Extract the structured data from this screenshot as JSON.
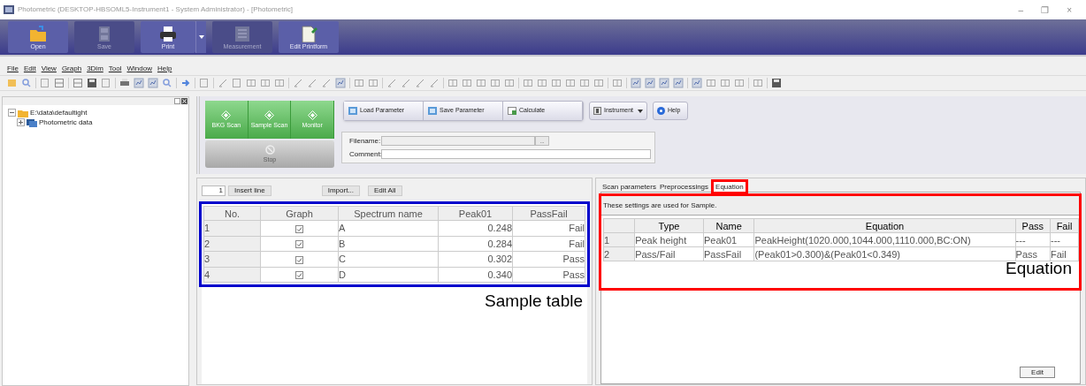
{
  "window": {
    "title": "Photometric (DESKTOP-HBSOML5-Instrument1 - System Administrator) - [Photometric]",
    "controls": [
      "–",
      "❐",
      "×"
    ]
  },
  "ribbon": [
    {
      "label": "Open",
      "kind": "folder",
      "disabled": false,
      "dropdown": false
    },
    {
      "label": "Save",
      "kind": "disk",
      "disabled": true,
      "dropdown": false
    },
    {
      "label": "Print",
      "kind": "printer",
      "disabled": false,
      "dropdown": true
    },
    {
      "label": "Measurement",
      "kind": "grid",
      "disabled": true,
      "dropdown": false
    },
    {
      "label": "Edit Printform",
      "kind": "page",
      "disabled": false,
      "dropdown": false
    }
  ],
  "menu": [
    "File",
    "Edit",
    "View",
    "Graph",
    "3Dim",
    "Tool",
    "Window",
    "Help"
  ],
  "tree": {
    "label": "E:\\data\\defaultight",
    "expanded": true,
    "children": [
      {
        "label": "Photometric data",
        "expanded": false
      }
    ]
  },
  "scan_buttons": [
    {
      "label": "BKG Scan",
      "disabled": false
    },
    {
      "label": "Sample Scan",
      "disabled": false
    },
    {
      "label": "Monitor",
      "disabled": false
    },
    {
      "label": "Stop",
      "disabled": true
    }
  ],
  "parameter_buttons": [
    "Load Parameter",
    "Save Parameter",
    "Calculate"
  ],
  "instrument_button": "Instrument",
  "help_button": "Help",
  "file": {
    "filename_label": "Filename:",
    "browse": "...",
    "comment_label": "Comment:"
  },
  "sample_toolbar": {
    "line_number": "1",
    "insert": "Insert line",
    "import": "Import...",
    "edit_all": "Edit All"
  },
  "sample_table": {
    "columns": [
      "No.",
      "Graph",
      "Spectrum name",
      "Peak01",
      "PassFail"
    ],
    "rows": [
      {
        "no": "1",
        "checked": true,
        "name": "A",
        "peak": "0.248",
        "result": "Fail"
      },
      {
        "no": "2",
        "checked": true,
        "name": "B",
        "peak": "0.284",
        "result": "Fail"
      },
      {
        "no": "3",
        "checked": true,
        "name": "C",
        "peak": "0.302",
        "result": "Pass"
      },
      {
        "no": "4",
        "checked": true,
        "name": "D",
        "peak": "0.340",
        "result": "Pass"
      }
    ]
  },
  "tabs": [
    {
      "label": "Scan parameters",
      "selected": false
    },
    {
      "label": "Preprocessings",
      "selected": false
    },
    {
      "label": "Equation",
      "selected": true
    }
  ],
  "equation_note": "These settings are used for Sample.",
  "equation_table": {
    "columns": [
      "",
      "Type",
      "Name",
      "Equation",
      "Pass",
      "Fail"
    ],
    "rows": [
      [
        "1",
        "Peak height",
        "Peak01",
        "PeakHeight(1020.000,1044.000,1110.000,BC:ON)",
        "---",
        "---"
      ],
      [
        "2",
        "Pass/Fail",
        "PassFail",
        "(Peak01>0.300)&(Peak01<0.349)",
        "Pass",
        "Fail"
      ]
    ]
  },
  "edit_button": "Edit",
  "annotations": [
    {
      "label": "Sample table",
      "color": "#0000cc"
    },
    {
      "label": "Equation",
      "color": "#ff0000"
    }
  ]
}
